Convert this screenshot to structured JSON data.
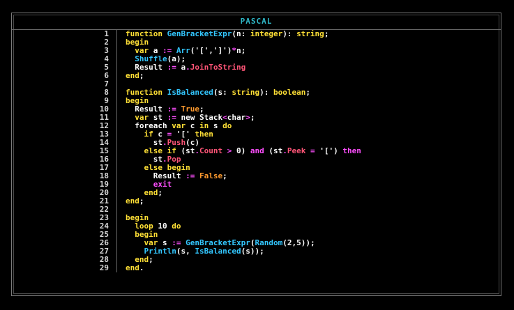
{
  "window": {
    "title": "PASCAL"
  },
  "editor": {
    "lines": [
      {
        "num": "1",
        "tokens": [
          [
            "kw",
            "function "
          ],
          [
            "fn",
            "GenBracketExpr"
          ],
          [
            "tx",
            "(n: "
          ],
          [
            "kw",
            "integer"
          ],
          [
            "tx",
            "): "
          ],
          [
            "kw",
            "string"
          ],
          [
            "tx",
            ";"
          ]
        ]
      },
      {
        "num": "2",
        "tokens": [
          [
            "kw",
            "begin"
          ]
        ]
      },
      {
        "num": "3",
        "tokens": [
          [
            "tx",
            "  "
          ],
          [
            "kw",
            "var "
          ],
          [
            "tx",
            "a "
          ],
          [
            "op",
            ":= "
          ],
          [
            "fn",
            "Arr"
          ],
          [
            "tx",
            "("
          ],
          [
            "str",
            "'['"
          ],
          [
            "tx",
            ","
          ],
          [
            "str",
            "']'"
          ],
          [
            "tx",
            ")"
          ],
          [
            "op",
            "*"
          ],
          [
            "tx",
            "n;"
          ]
        ]
      },
      {
        "num": "4",
        "tokens": [
          [
            "tx",
            "  "
          ],
          [
            "fn",
            "Shuffle"
          ],
          [
            "tx",
            "(a);"
          ]
        ]
      },
      {
        "num": "5",
        "tokens": [
          [
            "tx",
            "  Result "
          ],
          [
            "op",
            ":= "
          ],
          [
            "tx",
            "a"
          ],
          [
            "op",
            "."
          ],
          [
            "mem",
            "JoinToString"
          ]
        ]
      },
      {
        "num": "6",
        "tokens": [
          [
            "kw",
            "end"
          ],
          [
            "tx",
            ";"
          ]
        ]
      },
      {
        "num": "7",
        "tokens": []
      },
      {
        "num": "8",
        "tokens": [
          [
            "kw",
            "function "
          ],
          [
            "fn",
            "IsBalanced"
          ],
          [
            "tx",
            "(s: "
          ],
          [
            "kw",
            "string"
          ],
          [
            "tx",
            "): "
          ],
          [
            "kw",
            "boolean"
          ],
          [
            "tx",
            ";"
          ]
        ]
      },
      {
        "num": "9",
        "tokens": [
          [
            "kw",
            "begin"
          ]
        ]
      },
      {
        "num": "10",
        "tokens": [
          [
            "tx",
            "  Result "
          ],
          [
            "op",
            ":= "
          ],
          [
            "bool",
            "True"
          ],
          [
            "tx",
            ";"
          ]
        ]
      },
      {
        "num": "11",
        "tokens": [
          [
            "tx",
            "  "
          ],
          [
            "kw",
            "var "
          ],
          [
            "tx",
            "st "
          ],
          [
            "op",
            ":= "
          ],
          [
            "tx",
            "new Stack"
          ],
          [
            "op",
            "<"
          ],
          [
            "tx",
            "char"
          ],
          [
            "op",
            ">"
          ],
          [
            "tx",
            ";"
          ]
        ]
      },
      {
        "num": "12",
        "tokens": [
          [
            "tx",
            "  foreach "
          ],
          [
            "kw",
            "var "
          ],
          [
            "tx",
            "c "
          ],
          [
            "kw",
            "in "
          ],
          [
            "tx",
            "s "
          ],
          [
            "kw",
            "do"
          ]
        ]
      },
      {
        "num": "13",
        "tokens": [
          [
            "tx",
            "    "
          ],
          [
            "kw",
            "if "
          ],
          [
            "tx",
            "c "
          ],
          [
            "op",
            "= "
          ],
          [
            "str",
            "'[' "
          ],
          [
            "kw",
            "then"
          ]
        ]
      },
      {
        "num": "14",
        "tokens": [
          [
            "tx",
            "      st"
          ],
          [
            "op",
            "."
          ],
          [
            "mem",
            "Push"
          ],
          [
            "tx",
            "(c)"
          ]
        ]
      },
      {
        "num": "15",
        "tokens": [
          [
            "tx",
            "    "
          ],
          [
            "kw",
            "else if "
          ],
          [
            "tx",
            "(st"
          ],
          [
            "op",
            "."
          ],
          [
            "mem",
            "Count "
          ],
          [
            "op",
            "> "
          ],
          [
            "num",
            "0"
          ],
          [
            "tx",
            ") "
          ],
          [
            "op",
            "and "
          ],
          [
            "tx",
            "(st"
          ],
          [
            "op",
            "."
          ],
          [
            "mem",
            "Peek "
          ],
          [
            "op",
            "= "
          ],
          [
            "str",
            "'['"
          ],
          [
            "tx",
            ") "
          ],
          [
            "op",
            "then"
          ]
        ]
      },
      {
        "num": "16",
        "tokens": [
          [
            "tx",
            "      st"
          ],
          [
            "op",
            "."
          ],
          [
            "mem",
            "Pop"
          ]
        ]
      },
      {
        "num": "17",
        "tokens": [
          [
            "tx",
            "    "
          ],
          [
            "kw",
            "else begin"
          ]
        ]
      },
      {
        "num": "18",
        "tokens": [
          [
            "tx",
            "      Result "
          ],
          [
            "op",
            ":= "
          ],
          [
            "bool",
            "False"
          ],
          [
            "tx",
            ";"
          ]
        ]
      },
      {
        "num": "19",
        "tokens": [
          [
            "tx",
            "      "
          ],
          [
            "op",
            "exit"
          ]
        ]
      },
      {
        "num": "20",
        "tokens": [
          [
            "tx",
            "    "
          ],
          [
            "kw",
            "end"
          ],
          [
            "tx",
            ";"
          ]
        ]
      },
      {
        "num": "21",
        "tokens": [
          [
            "kw",
            "end"
          ],
          [
            "tx",
            ";"
          ]
        ]
      },
      {
        "num": "22",
        "tokens": []
      },
      {
        "num": "23",
        "tokens": [
          [
            "kw",
            "begin"
          ]
        ]
      },
      {
        "num": "24",
        "tokens": [
          [
            "tx",
            "  "
          ],
          [
            "kw",
            "loop "
          ],
          [
            "num",
            "10 "
          ],
          [
            "kw",
            "do"
          ]
        ]
      },
      {
        "num": "25",
        "tokens": [
          [
            "tx",
            "  "
          ],
          [
            "kw",
            "begin"
          ]
        ]
      },
      {
        "num": "26",
        "tokens": [
          [
            "tx",
            "    "
          ],
          [
            "kw",
            "var "
          ],
          [
            "tx",
            "s "
          ],
          [
            "op",
            ":= "
          ],
          [
            "fn",
            "GenBracketExpr"
          ],
          [
            "tx",
            "("
          ],
          [
            "fn",
            "Random"
          ],
          [
            "tx",
            "("
          ],
          [
            "num",
            "2"
          ],
          [
            "tx",
            ","
          ],
          [
            "num",
            "5"
          ],
          [
            "tx",
            "));"
          ]
        ]
      },
      {
        "num": "27",
        "tokens": [
          [
            "tx",
            "    "
          ],
          [
            "fn",
            "Println"
          ],
          [
            "tx",
            "(s, "
          ],
          [
            "fn",
            "IsBalanced"
          ],
          [
            "tx",
            "(s));"
          ]
        ]
      },
      {
        "num": "28",
        "tokens": [
          [
            "tx",
            "  "
          ],
          [
            "kw",
            "end"
          ],
          [
            "tx",
            ";"
          ]
        ]
      },
      {
        "num": "29",
        "tokens": [
          [
            "kw",
            "end"
          ],
          [
            "tx",
            "."
          ]
        ]
      }
    ]
  },
  "colors": {
    "background": "#000000",
    "title": "#2fb8c8",
    "keyword": "#ffe036",
    "function": "#33c7ff",
    "operator": "#ff4fff",
    "member": "#ff5577",
    "boolean": "#ff9a2e",
    "text": "#ffffff"
  }
}
